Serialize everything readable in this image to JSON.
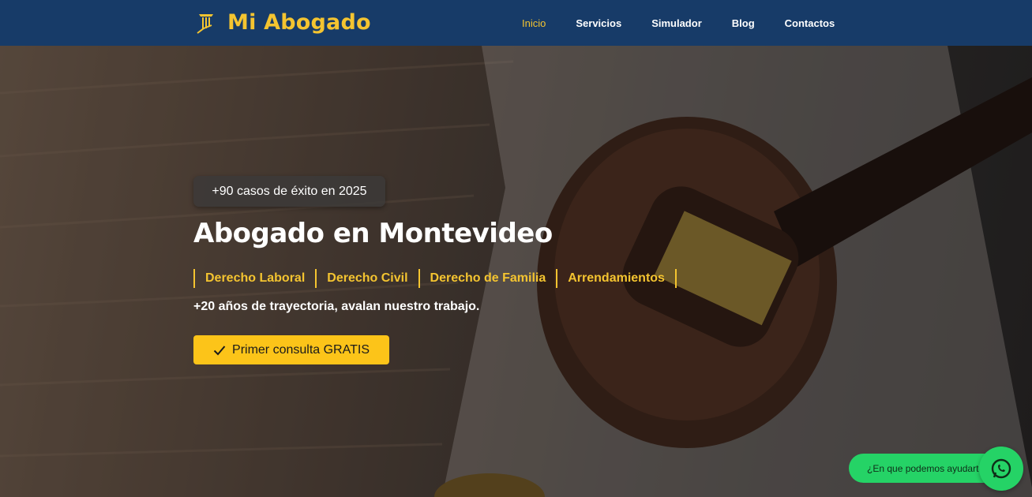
{
  "brand": {
    "name": "Mi Abogado",
    "accent": "#f4c430",
    "header_bg": "#173b68"
  },
  "nav": {
    "items": [
      {
        "label": "Inicio",
        "active": true
      },
      {
        "label": "Servicios",
        "active": false
      },
      {
        "label": "Simulador",
        "active": false
      },
      {
        "label": "Blog",
        "active": false
      },
      {
        "label": "Contactos",
        "active": false
      }
    ]
  },
  "hero": {
    "badge": "+90 casos de éxito en 2025",
    "title": "Abogado en Montevideo",
    "practice_areas": [
      "Derecho Laboral",
      "Derecho Civil",
      "Derecho de Familia",
      "Arrendamientos"
    ],
    "tagline": "+20 años de trayectoria, avalan nuestro trabajo.",
    "cta_label": "Primer consulta GRATIS",
    "cta_color": "#fcc419"
  },
  "whatsapp": {
    "label": "¿En que podemos ayudarte?",
    "color": "#25d366",
    "icon": "whatsapp-icon"
  }
}
